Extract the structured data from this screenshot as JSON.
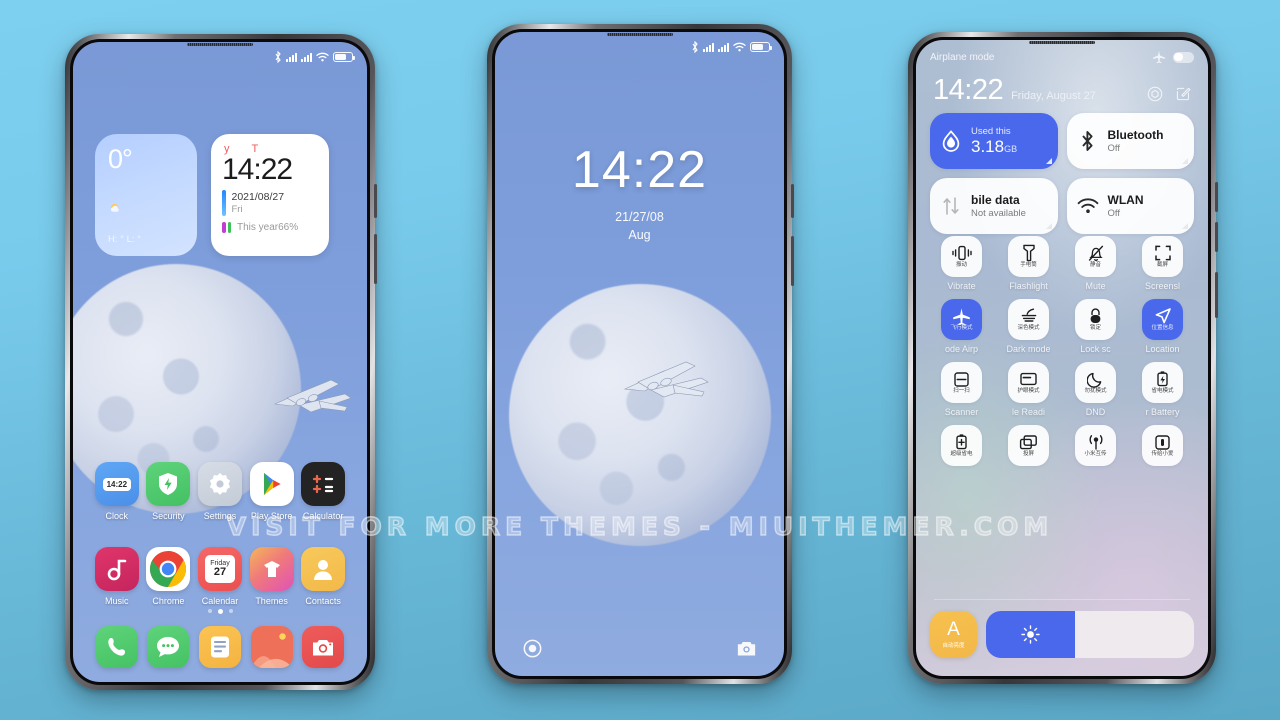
{
  "watermark": "VISIT  FOR  MORE  THEMES  -  MIUITHEMER.COM",
  "colors": {
    "accent_blue": "#4a68ec",
    "page_bg_top": "#7ed0f0",
    "page_bg_bottom": "#5aa7c6",
    "tile_on": "#4a68ec",
    "tile_off": "#ffffff",
    "auto_brightness": "#f5bd4b"
  },
  "phone1": {
    "statusbar": {
      "bluetooth_icon": "bluetooth-icon",
      "signal1_icon": "signal-bars-icon",
      "signal2_icon": "signal-bars-icon",
      "wifi_icon": "wifi-icon",
      "battery_icon": "battery-icon"
    },
    "weather_widget": {
      "temp": "0°",
      "weather_icon": "partly-sunny-icon",
      "high_low": "H: °  L: °"
    },
    "clock_widget": {
      "cn_left": "y",
      "cn_right": "T",
      "time": "14:22",
      "date": "2021/08/27",
      "weekday": "Fri",
      "year_progress": "This year66%"
    },
    "apps_row1": [
      {
        "label": "Clock",
        "icon": "clock-app-icon",
        "badge": "14:22"
      },
      {
        "label": "Security",
        "icon": "security-shield-icon"
      },
      {
        "label": "Settings",
        "icon": "settings-gear-icon"
      },
      {
        "label": "Play Store",
        "icon": "play-store-icon"
      },
      {
        "label": "Calculator",
        "icon": "calculator-icon"
      }
    ],
    "apps_row2": [
      {
        "label": "Music",
        "icon": "music-note-icon"
      },
      {
        "label": "Chrome",
        "icon": "chrome-icon"
      },
      {
        "label": "Calendar",
        "icon": "calendar-icon",
        "day_name": "Friday",
        "day_num": "27"
      },
      {
        "label": "Themes",
        "icon": "themes-icon"
      },
      {
        "label": "Contacts",
        "icon": "contacts-person-icon"
      }
    ],
    "dock": [
      {
        "name": "Phone",
        "icon": "phone-handset-icon"
      },
      {
        "name": "Messages",
        "icon": "messages-bubble-icon"
      },
      {
        "name": "Notes",
        "icon": "notes-document-icon"
      },
      {
        "name": "Gallery",
        "icon": "gallery-photos-icon"
      },
      {
        "name": "Camera",
        "icon": "camera-icon"
      }
    ],
    "page_dots": 3,
    "active_dot": 2
  },
  "phone2": {
    "time": "14:22",
    "date": "21/27/08",
    "month": "Aug",
    "left_shortcut_icon": "record-circle-icon",
    "right_shortcut_icon": "camera-icon"
  },
  "phone3": {
    "airplane_label": "Airplane mode",
    "airplane_icon": "airplane-icon",
    "time": "14:22",
    "date": "Friday, August 27",
    "settings_icon": "gear-icon",
    "edit_icon": "edit-pencil-icon",
    "big_tiles": [
      {
        "title": "3.18",
        "unit": "GB",
        "sub": "Used this",
        "icon": "data-drop-icon",
        "on": true,
        "style": "data"
      },
      {
        "title": "Bluetooth",
        "sub": "Off",
        "icon": "bluetooth-icon",
        "on": false,
        "style": "plain"
      },
      {
        "title": "bile data",
        "sub": "Not available",
        "icon": "mobile-data-icon",
        "on": false,
        "style": "dim"
      },
      {
        "title": "WLAN",
        "sub": "Off",
        "icon": "wifi-icon",
        "on": false,
        "style": "plain"
      }
    ],
    "small_tiles": [
      {
        "label": "Vibrate",
        "cjk": "振动",
        "icon": "vibrate-icon",
        "on": false
      },
      {
        "label": "Flashlight",
        "cjk": "手电筒",
        "icon": "flashlight-icon",
        "on": false
      },
      {
        "label": "Mute",
        "cjk": "静音",
        "icon": "mute-bell-icon",
        "on": false
      },
      {
        "label": "Screensl",
        "cjk": "截屏",
        "icon": "screenshot-icon",
        "on": false
      },
      {
        "label": "ode   Airp",
        "cjk": "飞行模式",
        "icon": "airplane-icon",
        "on": true
      },
      {
        "label": "Dark mode",
        "cjk": "深色模式",
        "icon": "dark-mode-icon",
        "on": false
      },
      {
        "label": "Lock sc",
        "cjk": "锁定",
        "icon": "lock-icon",
        "on": false
      },
      {
        "label": "Location",
        "cjk": "位置信息",
        "icon": "location-arrow-icon",
        "on": true
      },
      {
        "label": "Scanner",
        "cjk": "扫一扫",
        "icon": "scanner-icon",
        "on": false
      },
      {
        "label": "le   Readi",
        "cjk": "护眼模式",
        "icon": "reading-mode-icon",
        "on": false
      },
      {
        "label": "DND",
        "cjk": "勿扰模式",
        "icon": "moon-icon",
        "on": false
      },
      {
        "label": "r    Battery",
        "cjk": "省电模式",
        "icon": "battery-saver-icon",
        "on": false
      },
      {
        "label": "",
        "cjk": "超级省电",
        "icon": "ultra-battery-icon",
        "on": false
      },
      {
        "label": "",
        "cjk": "投屏",
        "icon": "cast-screen-icon",
        "on": false
      },
      {
        "label": "",
        "cjk": "小米互传",
        "icon": "mi-share-icon",
        "on": false
      },
      {
        "label": "",
        "cjk": "传给小爱",
        "icon": "mi-ai-icon",
        "on": false
      }
    ],
    "auto_brightness": {
      "letter": "A",
      "cjk": "自动亮度"
    },
    "brightness": {
      "icon": "brightness-sun-icon",
      "level": 43
    }
  }
}
